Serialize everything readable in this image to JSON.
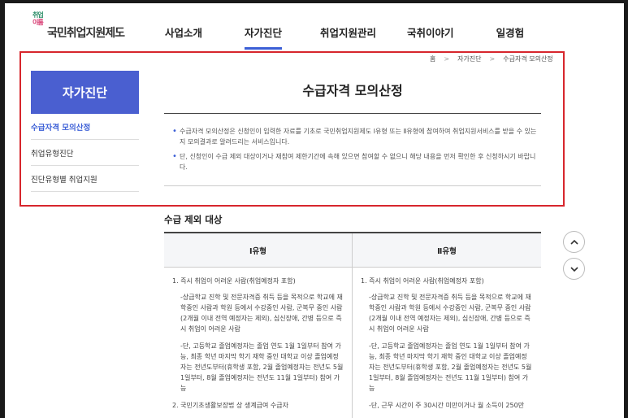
{
  "logo": {
    "mark_line1": "취업",
    "mark_line2": "이룸",
    "text": "국민취업지원제도"
  },
  "nav": {
    "items": [
      {
        "label": "사업소개"
      },
      {
        "label": "자가진단"
      },
      {
        "label": "취업지원관리"
      },
      {
        "label": "국취이야기"
      },
      {
        "label": "일경험"
      }
    ]
  },
  "breadcrumb": {
    "home": "홈",
    "level1": "자가진단",
    "level2": "수급자격 모의산정"
  },
  "sidebar": {
    "title": "자가진단",
    "items": [
      {
        "label": "수급자격 모의산정"
      },
      {
        "label": "취업유형진단"
      },
      {
        "label": "진단유형별 취업지원"
      }
    ]
  },
  "main": {
    "title": "수급자격 모의산정",
    "bullets": [
      "수급자격 모의산정은 신청인이 입력한 자료를 기초로 국민취업지원제도 Ⅰ유형 또는 Ⅱ유형에 참여하여 취업지원서비스를 받을 수 있는지 모의결과로 알려드리는 서비스입니다.",
      "단, 신청인이 수급 제외 대상이거나 재참여 제한기간에 속해 있으면 참여할 수 없으니 해당 내용을 먼저 확인한 후 신청하시기 바랍니다."
    ]
  },
  "exclusion": {
    "title": "수급 제외 대상",
    "headers": [
      "Ⅰ유형",
      "Ⅱ유형"
    ],
    "col1": [
      "1. 즉시 취업이 어려운 사람(취업예정자 포함)",
      "-상급학교 진학 및 전문자격증 취득 등을 목적으로 학교에 재학중인 사람과 학원 등에서 수강중인 사람, 군복무 중인 사람(2개월 이내 전역 예정자는 제외), 심신장애, 간병 등으로 즉시 취업이 어려운 사람",
      "-단, 고등학교 졸업예정자는 졸업 연도 1월 1일부터 참여 가능, 최종 학년 마지막 학기 재학 중인 대학교 이상 졸업예정자는 전년도부터(휴학생 포함, 2월 졸업예정자는 전년도 5월 1일부터, 8월 졸업예정자는 전년도 11월 1일부터) 참여 가능",
      "2. 국민기초생활보장법 상 생계급여 수급자"
    ],
    "col2": [
      "1. 즉시 취업이 어려운 사람(취업예정자 포함)",
      "-상급학교 진학 및 전문자격증 취득 등을 목적으로 학교에 재학중인 사람과 학원 등에서 수강중인 사람, 군복무 중인 사람(2개월 이내 전역 예정자는 제외), 심신장애, 간병 등으로 즉시 취업이 어려운 사람",
      "-단, 고등학교 졸업예정자는 졸업 연도 1월 1일부터 참여 가능, 최종 학년 마지막 학기 재학 중인 대학교 이상 졸업예정자는 전년도부터(휴학생 포함, 2월 졸업예정자는 전년도 5월 1일부터, 8월 졸업예정자는 전년도 11월 1일부터) 참여 가능",
      "-단, 근무 시간이 주 30시간 미만이거나 월 소득이 250만"
    ]
  },
  "colors": {
    "accent": "#4a5fd0",
    "highlight": "#d7262d"
  },
  "icons": {
    "scroll_up": "chevron-up-icon",
    "scroll_down": "chevron-down-icon"
  }
}
